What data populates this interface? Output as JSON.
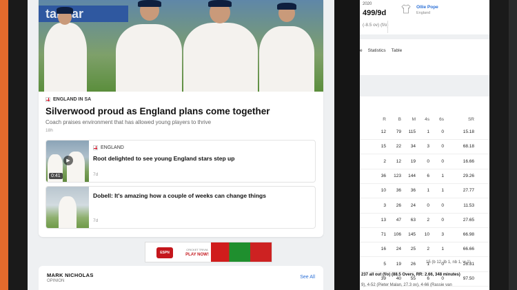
{
  "hero": {
    "sponsor": "tandar",
    "kicker": "ENGLAND IN SA",
    "headline": "Silverwood proud as England plans come together",
    "subhead": "Coach praises environment that has allowed young players to thrive",
    "age": "18h"
  },
  "stories": [
    {
      "kicker": "ENGLAND",
      "title": "Root delighted to see young England stars step up",
      "age": "7d",
      "duration": "0:41"
    },
    {
      "title": "Dobell: It's amazing how a couple of weeks can change things",
      "age": "7d"
    }
  ],
  "ad": {
    "badge": "ESPN",
    "small": "CRICKET TRIVIA",
    "cta": "PLAY NOW!"
  },
  "opinion": {
    "name": "MARK NICHOLAS",
    "sub": "OPINION",
    "see_all": "See All"
  },
  "scoreboard": {
    "season": "2020",
    "score": "499/9d",
    "overs": "(-8.5 ov) (f/o)",
    "pom_name": "Ollie Pope",
    "pom_team": "England"
  },
  "tabs": [
    "e",
    "Statistics",
    "Table"
  ],
  "table": {
    "headers": [
      "R",
      "B",
      "M",
      "4s",
      "6s",
      "SR"
    ],
    "rows": [
      [
        "12",
        "79",
        "115",
        "1",
        "0",
        "15.18"
      ],
      [
        "15",
        "22",
        "34",
        "3",
        "0",
        "68.18"
      ],
      [
        "2",
        "12",
        "19",
        "0",
        "0",
        "16.66"
      ],
      [
        "36",
        "123",
        "144",
        "6",
        "1",
        "29.26"
      ],
      [
        "10",
        "36",
        "36",
        "1",
        "1",
        "27.77"
      ],
      [
        "3",
        "26",
        "24",
        "0",
        "0",
        "11.53"
      ],
      [
        "13",
        "47",
        "63",
        "2",
        "0",
        "27.65"
      ],
      [
        "71",
        "106",
        "145",
        "10",
        "3",
        "66.98"
      ],
      [
        "16",
        "24",
        "25",
        "2",
        "1",
        "66.66"
      ],
      [
        "5",
        "19",
        "26",
        "1",
        "0",
        "26.31"
      ],
      [
        "39",
        "40",
        "55",
        "6",
        "0",
        "97.50"
      ]
    ],
    "extras": "15 (b 12, lb 1, nb 1, w 1)",
    "total": "237 all out (f/o) (88.5 Overs, RR: 2.66, 348 minutes)",
    "fow": "9), 4-52 (Pieter Malan, 27.3 ov), 4-66 (Rassie van"
  },
  "colors": {
    "link": "#2a6fd6",
    "frame_orange": "#e36a2c",
    "ad_red": "#c4161c"
  }
}
